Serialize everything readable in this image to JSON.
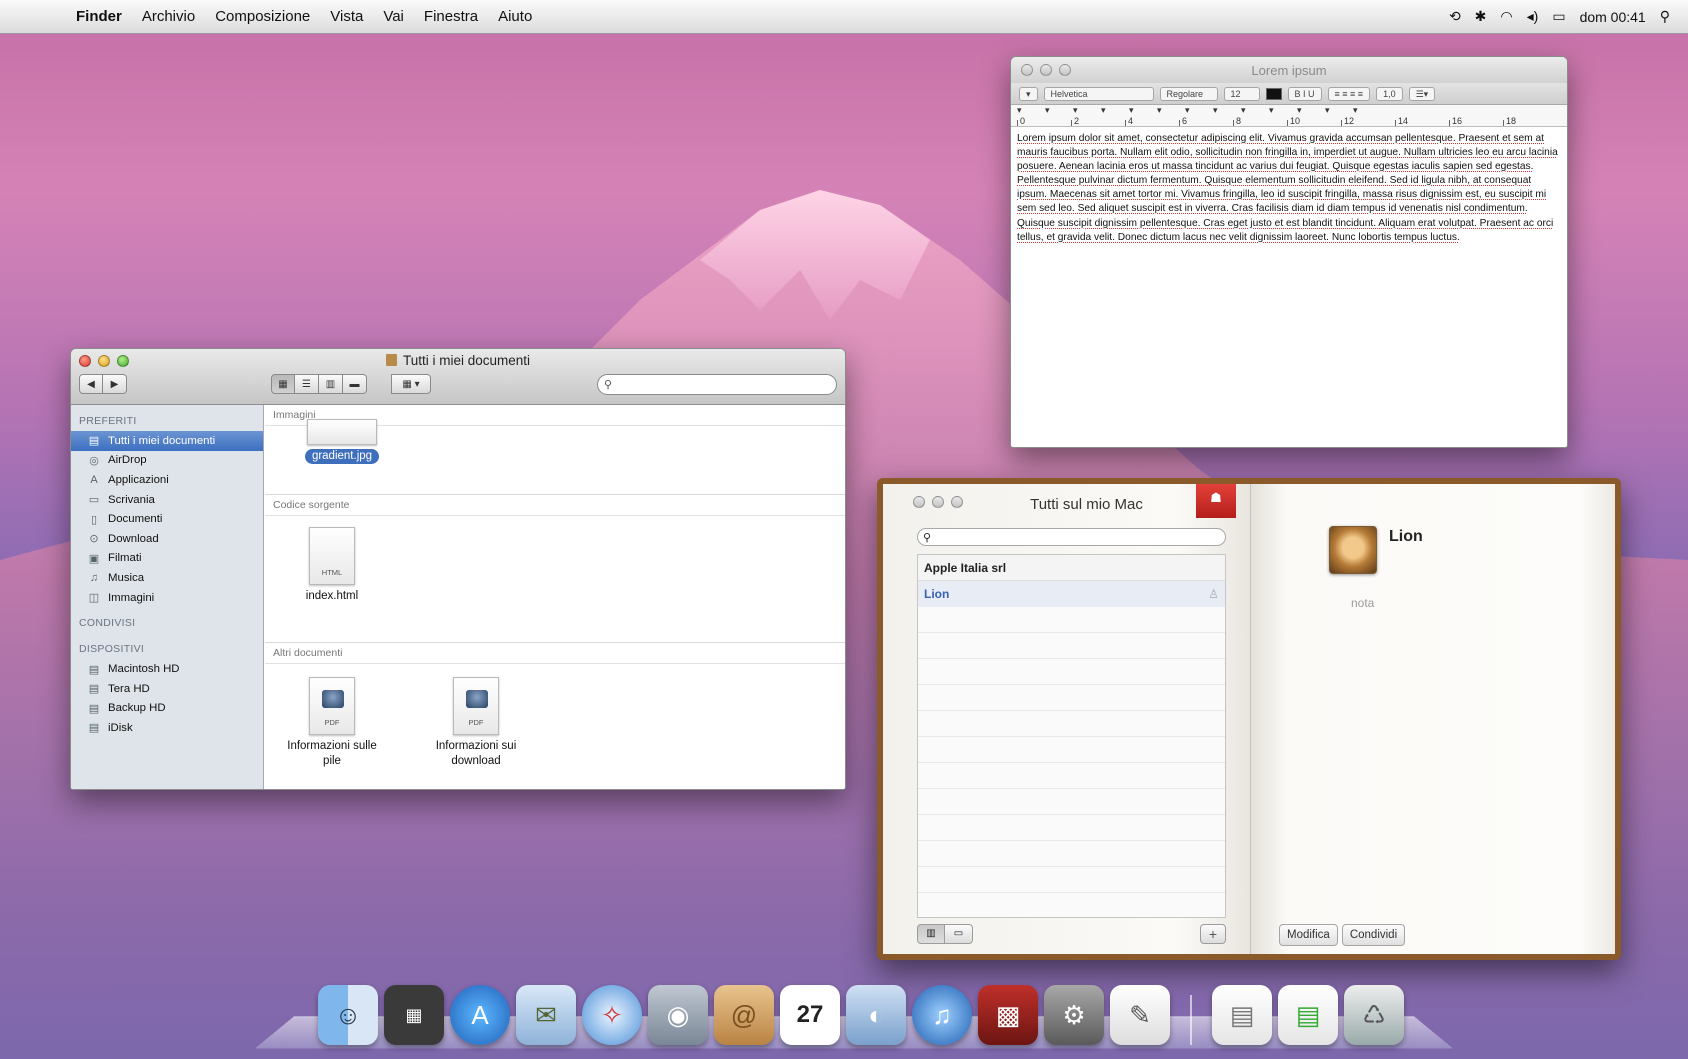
{
  "menubar": {
    "apple": "",
    "items": [
      "Finder",
      "Archivio",
      "Composizione",
      "Vista",
      "Vai",
      "Finestra",
      "Aiuto"
    ],
    "clock": "dom 00:41"
  },
  "editor": {
    "title": "Lorem ipsum",
    "font": "Helvetica",
    "style": "Regolare",
    "size": "12",
    "spacing": "1,0",
    "ruler_labels": [
      "0",
      "2",
      "4",
      "6",
      "8",
      "10",
      "12",
      "14",
      "16",
      "18"
    ],
    "text": "Lorem ipsum dolor sit amet, consectetur adipiscing elit. Vivamus gravida accumsan pellentesque. Praesent et sem at mauris faucibus porta. Nullam elit odio, sollicitudin non fringilla in, imperdiet ut augue. Nullam ultricies leo eu arcu lacinia posuere. Aenean lacinia eros ut massa tincidunt ac varius dui feugiat. Quisque egestas iaculis sapien sed egestas. Pellentesque pulvinar dictum fermentum. Quisque elementum sollicitudin eleifend. Sed id ligula nibh, at consequat ipsum. Maecenas sit amet tortor mi. Vivamus fringilla, leo id suscipit fringilla, massa risus dignissim est, eu suscipit mi sem sed leo. Sed aliquet suscipit est in viverra. Cras facilisis diam id diam tempus id venenatis nisl condimentum. Quisque suscipit dignissim pellentesque. Cras eget justo et est blandit tincidunt. Aliquam erat volutpat. Praesent ac orci tellus, et gravida velit. Donec dictum lacus nec velit dignissim laoreet. Nunc lobortis tempus luctus."
  },
  "finder": {
    "title": "Tutti i miei documenti",
    "sidebar": {
      "favorites_header": "PREFERITI",
      "favorites": [
        {
          "label": "Tutti i miei documenti",
          "icon": "all-documents-icon",
          "selected": true
        },
        {
          "label": "AirDrop",
          "icon": "airdrop-icon"
        },
        {
          "label": "Applicazioni",
          "icon": "applications-icon"
        },
        {
          "label": "Scrivania",
          "icon": "desktop-icon"
        },
        {
          "label": "Documenti",
          "icon": "documents-icon"
        },
        {
          "label": "Download",
          "icon": "download-icon"
        },
        {
          "label": "Filmati",
          "icon": "movies-icon"
        },
        {
          "label": "Musica",
          "icon": "music-icon"
        },
        {
          "label": "Immagini",
          "icon": "pictures-icon"
        }
      ],
      "shared_header": "CONDIVISI",
      "devices_header": "DISPOSITIVI",
      "devices": [
        {
          "label": "Macintosh HD",
          "icon": "disk-icon"
        },
        {
          "label": "Tera HD",
          "icon": "disk-icon"
        },
        {
          "label": "Backup HD",
          "icon": "disk-icon"
        },
        {
          "label": "iDisk",
          "icon": "idisk-icon"
        }
      ]
    },
    "groups": [
      {
        "header": "Immagini",
        "files": [
          {
            "label": "gradient.jpg",
            "selected": true
          }
        ]
      },
      {
        "header": "Codice sorgente",
        "files": [
          {
            "label": "index.html",
            "tag": "HTML"
          }
        ]
      },
      {
        "header": "Altri documenti",
        "files": [
          {
            "label": "Informazioni sulle pile",
            "tag": "PDF"
          },
          {
            "label": "Informazioni sui download",
            "tag": "PDF"
          }
        ]
      }
    ]
  },
  "addressbook": {
    "title": "Tutti sul mio Mac",
    "group_header": "Apple Italia srl",
    "contacts": [
      {
        "name": "Lion",
        "selected": true
      }
    ],
    "card": {
      "name": "Lion",
      "note_placeholder": "nota"
    },
    "buttons": {
      "edit": "Modifica",
      "share": "Condividi",
      "add": "+"
    }
  },
  "dock": {
    "apps": [
      "Finder",
      "Dashboard",
      "App Store",
      "Mail",
      "Safari",
      "FaceTime",
      "Rubrica",
      "iCal",
      "Anteprima",
      "iTunes",
      "Photo Booth",
      "Preferenze di Sistema",
      "TextEdit",
      "Documenti",
      "Download",
      "Cestino"
    ]
  }
}
